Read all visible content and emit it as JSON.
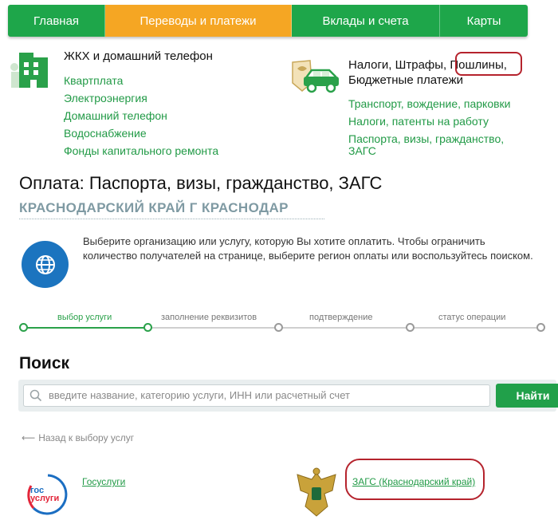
{
  "nav": {
    "tabs": [
      {
        "label": "Главная",
        "active": false
      },
      {
        "label": "Переводы и платежи",
        "active": true
      },
      {
        "label": "Вклады и счета",
        "active": false
      },
      {
        "label": "Карты",
        "active": false
      }
    ]
  },
  "categories": {
    "utilities": {
      "title": "ЖКХ и домашний телефон",
      "icon": "building-icon",
      "links": [
        "Квартплата",
        "Электроэнергия",
        "Домашний телефон",
        "Водоснабжение",
        "Фонды капитального ремонта"
      ]
    },
    "taxes": {
      "title_part1": "Налоги, Штрафы, ",
      "title_highlight": "Пошлины,",
      "title_line2": "Бюджетные платежи",
      "icon": "car-emblem-icon",
      "links": [
        "Транспорт, вождение, парковки",
        "Налоги, патенты на работу",
        "Паспорта, визы, гражданство, ЗАГС"
      ]
    }
  },
  "page": {
    "title": "Оплата: Паспорта, визы, гражданство, ЗАГС",
    "region": "КРАСНОДАРСКИЙ КРАЙ Г КРАСНОДАР",
    "info": "Выберите организацию или услугу, которую Вы хотите оплатить. Чтобы ограничить количество получателей на странице, выберите регион оплаты или воспользуйтесь поиском."
  },
  "stepper": {
    "steps": [
      "выбор услуги",
      "заполнение реквизитов",
      "подтверждение",
      "статус операции"
    ],
    "active_index": 0
  },
  "search": {
    "title": "Поиск",
    "placeholder": "введите название, категорию услуги, ИНН или расчетный счет",
    "button": "Найти"
  },
  "back_link": "Назад к выбору услуг",
  "results": [
    {
      "label": "Госуслуги",
      "logo_text_top": "гос",
      "logo_text_bottom": "услуги"
    },
    {
      "label": "ЗАГС (Краснодарский край)",
      "highlighted": true
    }
  ],
  "colors": {
    "brand_green": "#1ea64a",
    "active_tab": "#f5a623",
    "link_green": "#219a46",
    "highlight_red": "#b5232d",
    "info_blue": "#1b74bf"
  }
}
